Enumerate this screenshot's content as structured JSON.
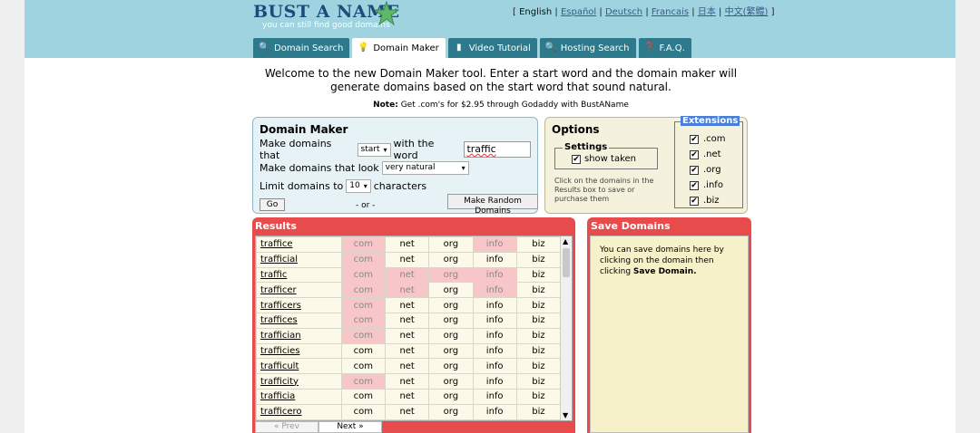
{
  "logo": {
    "title": "BUST A NAME",
    "tagline": "you can still find good domains"
  },
  "languages": {
    "open": "[",
    "current": "English",
    "sep": "|",
    "items": [
      "Español",
      "Deutsch",
      "Francais",
      "日本",
      "中文(繁體)"
    ],
    "close": "]"
  },
  "tabs": [
    {
      "label": "Domain Search",
      "icon": "magnifier-icon"
    },
    {
      "label": "Domain Maker",
      "icon": "lightbulb-icon",
      "active": true
    },
    {
      "label": "Video Tutorial",
      "icon": "film-icon"
    },
    {
      "label": "Hosting Search",
      "icon": "magnifier-icon"
    },
    {
      "label": "F.A.Q.",
      "icon": "help-icon"
    }
  ],
  "intro": "Welcome to the new Domain Maker tool. Enter a start word and the domain maker will generate domains based on the start word that sound natural.",
  "note": {
    "label": "Note:",
    "text": "Get .com's for $2.95 through Godaddy with BustAName"
  },
  "domain_maker": {
    "title": "Domain Maker",
    "row1_pre": "Make domains that",
    "position_value": "start",
    "row1_mid": "with the word",
    "word_value": "traffic",
    "row2_pre": "Make domains that look",
    "look_value": "very natural",
    "row3_pre": "Limit domains to",
    "limit_value": "10",
    "row3_post": "characters",
    "go_label": "Go",
    "or_label": "- or -",
    "random_label": "Make Random Domains"
  },
  "options": {
    "title": "Options",
    "settings_legend": "Settings",
    "show_taken_label": "show taken",
    "note": "Click on the domains in the Results box to save or purchase them",
    "extensions_legend": "Extensions",
    "extensions": [
      ".com",
      ".net",
      ".org",
      ".info",
      ".biz"
    ]
  },
  "results": {
    "title": "Results",
    "tld_labels": [
      "com",
      "net",
      "org",
      "info",
      "biz"
    ],
    "rows": [
      {
        "name": "traffice",
        "taken": [
          true,
          false,
          false,
          true,
          false
        ]
      },
      {
        "name": "trafficial",
        "taken": [
          true,
          false,
          false,
          false,
          false
        ]
      },
      {
        "name": "traffic",
        "taken": [
          true,
          true,
          true,
          true,
          false
        ]
      },
      {
        "name": "trafficer",
        "taken": [
          true,
          true,
          false,
          true,
          false
        ]
      },
      {
        "name": "trafficers",
        "taken": [
          true,
          false,
          false,
          false,
          false
        ]
      },
      {
        "name": "traffices",
        "taken": [
          true,
          false,
          false,
          false,
          false
        ]
      },
      {
        "name": "traffician",
        "taken": [
          true,
          false,
          false,
          false,
          false
        ]
      },
      {
        "name": "trafficies",
        "taken": [
          false,
          false,
          false,
          false,
          false
        ]
      },
      {
        "name": "trafficult",
        "taken": [
          false,
          false,
          false,
          false,
          false
        ]
      },
      {
        "name": "trafficity",
        "taken": [
          true,
          false,
          false,
          false,
          false
        ]
      },
      {
        "name": "trafficia",
        "taken": [
          false,
          false,
          false,
          false,
          false
        ]
      },
      {
        "name": "trafficero",
        "taken": [
          false,
          false,
          false,
          false,
          false
        ]
      }
    ],
    "prev_label": "« Prev",
    "next_label": "Next »"
  },
  "save_domains": {
    "title": "Save Domains",
    "text": "You can save domains here by clicking on the domain then clicking",
    "bold": "Save Domain."
  },
  "colors": {
    "header": "#9ed3df",
    "tab": "#2c7a8b",
    "panel_red": "#e84b4b",
    "taken_cell": "#f6c6c9"
  }
}
